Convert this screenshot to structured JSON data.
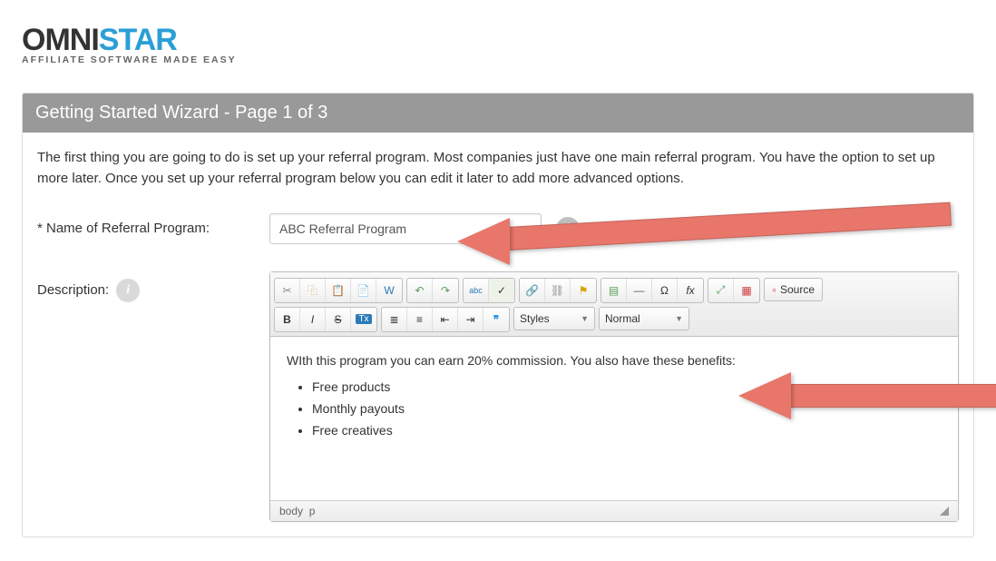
{
  "logo": {
    "main": "OMNI",
    "accent": "STAR",
    "tagline": "AFFILIATE SOFTWARE MADE EASY"
  },
  "card": {
    "title": "Getting Started Wizard - Page 1 of 3",
    "intro": "The first thing you are going to do is set up your referral program. Most companies just have one main referral program. You have the option to set up more later. Once you set up your referral program below you can edit it later to add more advanced options."
  },
  "fields": {
    "name_label": "* Name of Referral Program:",
    "name_value": "ABC Referral Program",
    "desc_label": "Description:"
  },
  "editor": {
    "styles_label": "Styles",
    "format_label": "Normal",
    "source_label": "Source",
    "content_intro": "WIth this program you can earn 20% commission. You also have these benefits:",
    "bullets": [
      "Free products",
      "Monthly payouts",
      "Free creatives"
    ],
    "path_body": "body",
    "path_p": "p"
  },
  "icons": {
    "cut": "✂",
    "copy": "⿻",
    "paste": "📋",
    "paste_text": "📄",
    "paste_word": "W",
    "undo": "↶",
    "redo": "↷",
    "spell": "abc",
    "spell_auto": "✓",
    "link": "🔗",
    "unlink": "⛓",
    "anchor": "⚑",
    "image": "▤",
    "hr": "—",
    "char": "Ω",
    "fx": "fx",
    "maximize": "⤢",
    "blocks": "▦",
    "bold": "B",
    "italic": "I",
    "strike": "S",
    "remove_format": "Tx",
    "ul": "≣",
    "ol": "≡",
    "outdent": "⇤",
    "indent": "⇥",
    "quote": "❞"
  }
}
